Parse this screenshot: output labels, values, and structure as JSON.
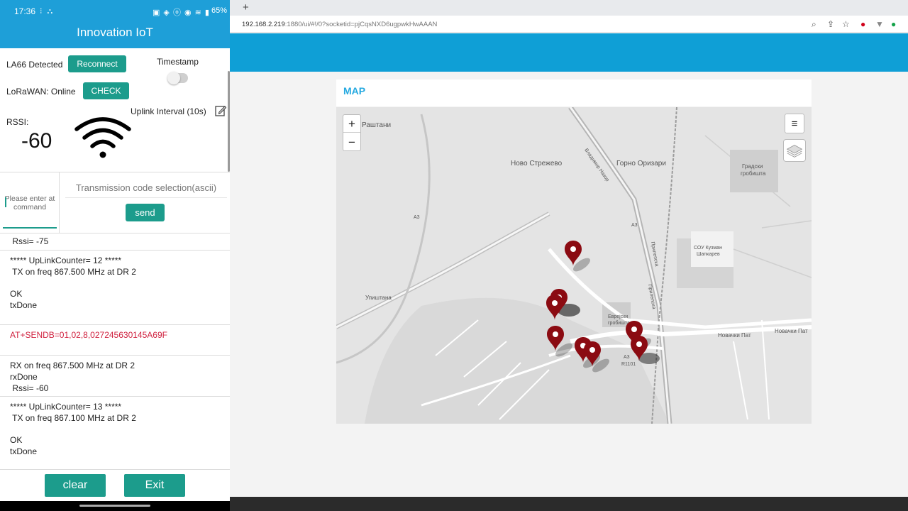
{
  "status_bar": {
    "time": "17:36",
    "notif_icons": "⁝ ⛬",
    "system_icons": "▣ ◈ ⓞ ◉ ≋ ▮",
    "battery": "65%"
  },
  "app": {
    "title": "Innovation IoT",
    "device_status": "LA66 Detected",
    "reconnect_label": "Reconnect",
    "timestamp_label": "Timestamp",
    "lorawan_status": "LoRaWAN:  Online",
    "check_label": "CHECK",
    "uplink_interval": "Uplink Interval  (10s)",
    "rssi_label": "RSSI:",
    "rssi_value": "-60",
    "command_placeholder": "Please enter at command",
    "code_selection_placeholder": "Transmission code selection(ascii)",
    "send_label": "send",
    "clear_label": "clear",
    "exit_label": "Exit"
  },
  "log": [
    {
      "text": " Rssi= -75",
      "kind": "normal"
    },
    {
      "text": "***** UpLinkCounter= 12 *****",
      "kind": "normal"
    },
    {
      "text": " TX on freq 867.500 MHz at DR 2",
      "kind": "normal"
    },
    {
      "text": "OK",
      "kind": "normal"
    },
    {
      "text": "txDone",
      "kind": "normal"
    },
    {
      "text": "AT+SENDB=01,02,8,027245630145A69F",
      "kind": "command"
    },
    {
      "text": "RX on freq 867.500 MHz at DR 2",
      "kind": "normal"
    },
    {
      "text": "rxDone",
      "kind": "normal"
    },
    {
      "text": " Rssi= -60",
      "kind": "normal"
    },
    {
      "text": "***** UpLinkCounter= 13 *****",
      "kind": "normal"
    },
    {
      "text": " TX on freq 867.100 MHz at DR 2",
      "kind": "normal"
    },
    {
      "text": "OK",
      "kind": "normal"
    },
    {
      "text": "txDone",
      "kind": "normal"
    }
  ],
  "browser": {
    "new_tab_symbol": "+",
    "url_host": "192.168.2.219",
    "url_rest": ":1880/ui/#!/0?socketid=pjCqsNXD6ugpwkHwAAAN"
  },
  "dashboard": {
    "map_title": "MAP",
    "zoom_in": "+",
    "zoom_out": "−",
    "layers_menu": "≡"
  },
  "map_labels": {
    "rashtani": "Раштани",
    "novo_strezhevo": "Ново Стрежево",
    "gorno_orizari": "Горно Оризари",
    "gradski_grobishta_1": "Градски",
    "gradski_grobishta_2": "гробишта",
    "sou_1": "СОУ Кузман",
    "sou_2": "Шапкарев",
    "upishtana": "Упиштана",
    "novachki_pat": "Новачки Пат",
    "novachki_pat_2": "Новачки Пат",
    "vladimir_nazor": "Владимир Назор",
    "a3_1": "А3",
    "a3_2": "А3",
    "a3_3": "А3",
    "r1101": "R1101",
    "prilepska": "Прилепска",
    "prilepska_2": "Прилепска",
    "grobishta_2": "гробишта",
    "evrejski": "Еврејски"
  }
}
